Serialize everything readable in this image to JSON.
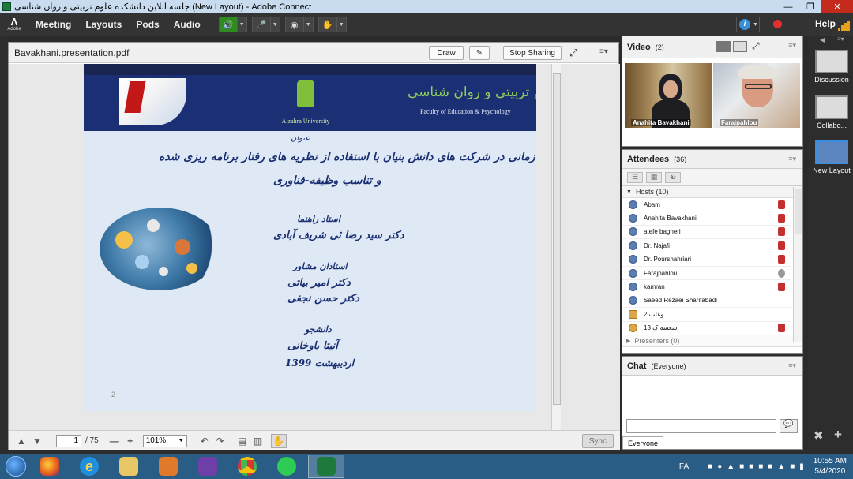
{
  "titlebar": {
    "title": "جلسه آنلاین دانشکده علوم تربیتی و روان شناسی (New Layout) - Adobe Connect"
  },
  "menubar": {
    "adobe_label": "Adobe",
    "items": [
      "Meeting",
      "Layouts",
      "Pods",
      "Audio"
    ],
    "help_label": "Help"
  },
  "share_pod": {
    "title": "Bavakhani.presentation.pdf",
    "draw_label": "Draw",
    "stop_sharing_label": "Stop Sharing",
    "page_input": "1",
    "page_total": "/ 75",
    "zoom": "101%",
    "sync_label": "Sync"
  },
  "slide": {
    "university_name": "Alzahra University",
    "faculty_fa": "دانشکده علوم تربیتی و روان شناسی",
    "faculty_en": "Faculty of Education & Psychology",
    "subject_label": "عنوان",
    "title_line1": "توسعه مدل خلق دانش سازمانی در شرکت های دانش بنیان با استفاده از نظریه های رفتار برنامه ریزی شده",
    "title_line2": "و تناسب وظیفه-فناوری",
    "advisor_label": "استاد راهنما",
    "advisor_name": "دکتر سید رضا ئی شریف آبادی",
    "consultants_label": "استادان مشاور",
    "consultant1": "دکتر امیر بیاتی",
    "consultant2": "دکتر حسن نجفی",
    "student_label": "دانشجو",
    "student_name": "آنیتا باوخانی",
    "date": "اردیبهشت 1399",
    "page_number": "2"
  },
  "video_pod": {
    "title": "Video",
    "count": "(2)",
    "feeds": [
      "Anahita Bavakhani",
      "Farajpahlou"
    ]
  },
  "attendees_pod": {
    "title": "Attendees",
    "count": "(36)",
    "hosts_label": "Hosts (10)",
    "hosts": [
      "Abam",
      "Anahita Bavakhani",
      "atefe bagheri",
      "Dr. Najafi",
      "Dr. Pourshahriari",
      "Farajpahlou",
      "kamran",
      "Saeed Rezaei Sharifabadi",
      "2 وغلب",
      "13 سعسه ک"
    ],
    "presenters_label": "Presenters (0)"
  },
  "chat_pod": {
    "title": "Chat",
    "scope": "(Everyone)",
    "recipient_tab": "Everyone"
  },
  "layouts": [
    "Discussion",
    "Collabo...",
    "New Layout"
  ],
  "taskbar": {
    "lang": "FA",
    "time": "10:55 AM",
    "date": "5/4/2020"
  }
}
